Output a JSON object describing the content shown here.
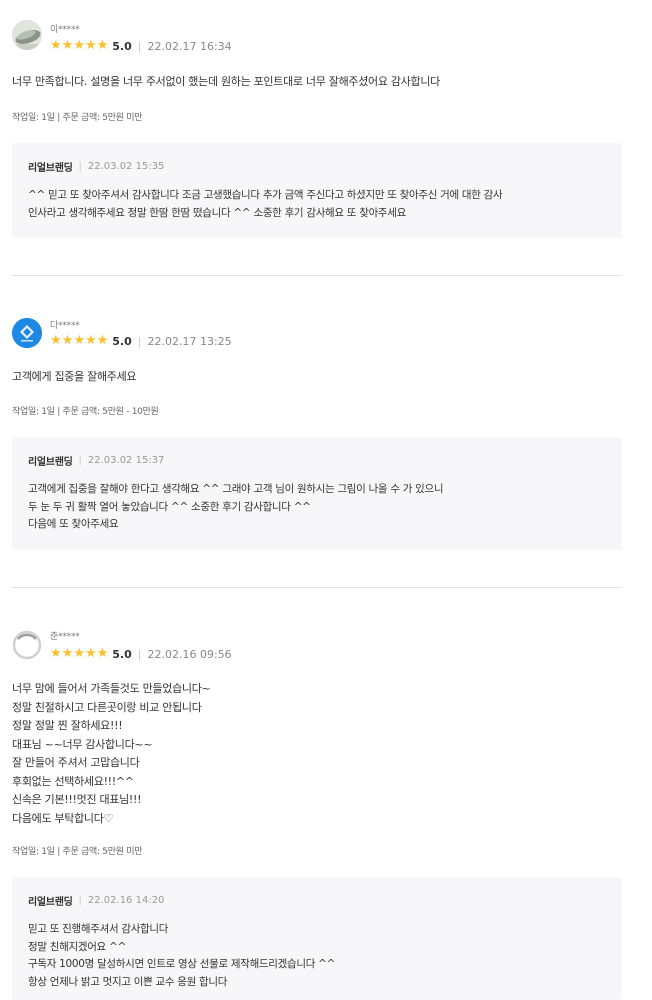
{
  "colors": {
    "star": "#fbc02d",
    "reply_bg": "#f7f7f9",
    "divider": "#e3e3e3"
  },
  "reviews": [
    {
      "nickname": "이*****",
      "avatar_icon": "stone-photo-icon",
      "score": "5.0",
      "date": "22.02.17 16:34",
      "text": "너무 만족합니다. 설명을 너무 주서없이 했는데 원하는 포인트대로 너무 잘해주셨어요 감사합니다",
      "meta": "작업일: 1일 | 주문 금액: 5만원 미만",
      "reply": {
        "author": "리얼브랜딩",
        "date": "22.03.02 15:35",
        "text": "^^ 믿고 또 찾아주셔서 감사합니다 조금 고생했습니다 추가 금액 주신다고 하셨지만 또 찾아주신 거에 대한 감사\n인사라고 생각해주세요 정말 한땀 한땀 떴습니다 ^^ 소중한 후기 감사해요 또 찾아주세요"
      }
    },
    {
      "nickname": "다*****",
      "avatar_icon": "blue-logo-icon",
      "score": "5.0",
      "date": "22.02.17 13:25",
      "text": "고객에게 집중을 잘해주세요",
      "meta": "작업일: 1일 | 주문 금액: 5만원 - 10만원",
      "reply": {
        "author": "리얼브랜딩",
        "date": "22.03.02 15:37",
        "text": "고객에게 집중을 잘해야 한다고 생각해요 ^^ 그래야 고객 님이 원하시는 그림이 나올 수 가 있으니\n두 눈 두 귀 활짝 열어 놓았습니다 ^^ 소중한 후기 감사합니다 ^^\n다음에 또 찾아주세요"
      }
    },
    {
      "nickname": "준*****",
      "avatar_icon": "default-avatar-icon",
      "score": "5.0",
      "date": "22.02.16 09:56",
      "text": "너무 맘에 들어서 가족들것도 만들었습니다~\n정말 친절하시고 다른곳이랑 비교 안됩니다\n정말 정말 찐 잘하세요!!!\n대표님 ~~너무 감사합니다~~\n잘 만들어 주셔서 고맙습니다\n후회없는 선택하세요!!!^^\n신속은 기본!!!멋진 대표님!!!\n다음에도 부탁합니다♡",
      "meta": "작업일: 1일 | 주문 금액: 5만원 미만",
      "reply": {
        "author": "리얼브랜딩",
        "date": "22.02.16 14:20",
        "text": "믿고 또 진행해주셔서 감사합니다\n정말 친해지겠어요 ^^\n구독자 1000명 달성하시면 인트로 영상 선물로 제작해드리겠습니다 ^^\n항상 언제나 밝고 멋지고 이쁜 교수 응원 합니다"
      }
    }
  ]
}
